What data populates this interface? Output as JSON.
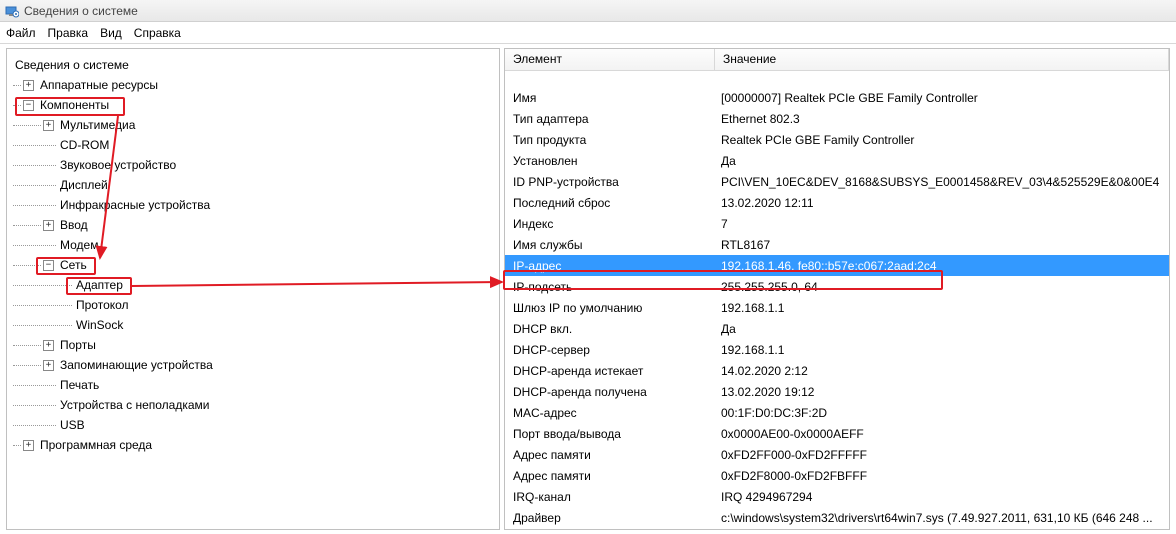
{
  "window": {
    "title": "Сведения о системе"
  },
  "menu": {
    "file": "Файл",
    "edit": "Правка",
    "view": "Вид",
    "help": "Справка"
  },
  "tree": {
    "root": "Сведения о системе",
    "hw": "Аппаратные ресурсы",
    "components": "Компоненты",
    "multimedia": "Мультимедиа",
    "cdrom": "CD-ROM",
    "sound": "Звуковое устройство",
    "display": "Дисплей",
    "infrared": "Инфракрасные устройства",
    "input": "Ввод",
    "modem": "Модем",
    "network": "Сеть",
    "adapter": "Адаптер",
    "protocol": "Протокол",
    "winsock": "WinSock",
    "ports": "Порты",
    "storage": "Запоминающие устройства",
    "print": "Печать",
    "problem": "Устройства с неполадками",
    "usb": "USB",
    "swenv": "Программная среда"
  },
  "columns": {
    "element": "Элемент",
    "value": "Значение"
  },
  "details": [
    {
      "el": "Имя",
      "val": "[00000007] Realtek PCIe GBE Family Controller"
    },
    {
      "el": "Тип адаптера",
      "val": "Ethernet 802.3"
    },
    {
      "el": "Тип продукта",
      "val": "Realtek PCIe GBE Family Controller"
    },
    {
      "el": "Установлен",
      "val": "Да"
    },
    {
      "el": "ID PNP-устройства",
      "val": "PCI\\VEN_10EC&DEV_8168&SUBSYS_E0001458&REV_03\\4&525529E&0&00E4"
    },
    {
      "el": "Последний сброс",
      "val": "13.02.2020 12:11"
    },
    {
      "el": "Индекс",
      "val": "7"
    },
    {
      "el": "Имя службы",
      "val": "RTL8167"
    },
    {
      "el": "IP-адрес",
      "val": "192.168.1.46, fe80::b57e:c067:2aad:2c4",
      "selected": true
    },
    {
      "el": "IP-подсеть",
      "val": "255.255.255.0, 64"
    },
    {
      "el": "Шлюз IP по умолчанию",
      "val": "192.168.1.1"
    },
    {
      "el": "DHCP вкл.",
      "val": "Да"
    },
    {
      "el": "DHCP-сервер",
      "val": "192.168.1.1"
    },
    {
      "el": "DHCP-аренда истекает",
      "val": "14.02.2020 2:12"
    },
    {
      "el": "DHCP-аренда получена",
      "val": "13.02.2020 19:12"
    },
    {
      "el": "MAC-адрес",
      "val": "00:1F:D0:DC:3F:2D"
    },
    {
      "el": "Порт ввода/вывода",
      "val": "0x0000AE00-0x0000AEFF"
    },
    {
      "el": "Адрес памяти",
      "val": "0xFD2FF000-0xFD2FFFFF"
    },
    {
      "el": "Адрес памяти",
      "val": "0xFD2F8000-0xFD2FBFFF"
    },
    {
      "el": "IRQ-канал",
      "val": "IRQ 4294967294"
    },
    {
      "el": "Драйвер",
      "val": "c:\\windows\\system32\\drivers\\rt64win7.sys (7.49.927.2011, 631,10 КБ (646 248 ..."
    }
  ]
}
